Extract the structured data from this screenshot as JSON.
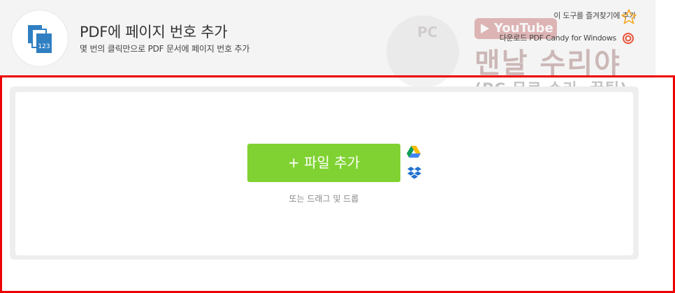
{
  "header": {
    "title": "PDF에 페이지 번호 추가",
    "subtitle": "몇 번의 클릭만으로 PDF 문서에 페이지 번호 추가",
    "logo_icon": "pdf-page-number-icon",
    "logo_text": "123"
  },
  "links": {
    "favorite": "이 도구를 즐겨찾기에 추가",
    "favorite_icon": "star-icon",
    "download": "다운로드 PDF Candy for Windows",
    "download_icon": "spiral-icon"
  },
  "watermark": {
    "pc_text": "PC",
    "youtube_text": "YouTube",
    "big_text": "맨날 수리야",
    "small_text": "(PC 무료 수리, 꿀팁)"
  },
  "upload": {
    "add_file_label": "+ 파일 추가",
    "hint": "또는 드래그 및 드롭",
    "gdrive_icon": "google-drive-icon",
    "dropbox_icon": "dropbox-icon"
  },
  "colors": {
    "accent_green": "#7fd232",
    "logo_blue": "#2f7fc2",
    "highlight_red": "#ee0000",
    "star_orange": "#f5a623"
  }
}
